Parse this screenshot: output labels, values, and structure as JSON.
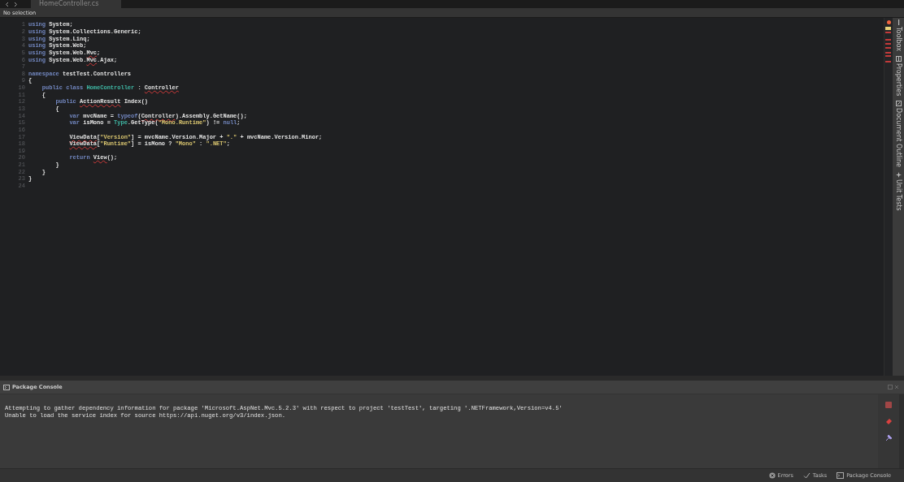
{
  "editor_tab": {
    "title": "HomeController.cs"
  },
  "breadcrumb": "No selection",
  "code_lines": [
    {
      "number": "1",
      "tokens": [
        {
          "text": "using ",
          "kind": "keyword"
        },
        {
          "text": "System;",
          "kind": "text"
        }
      ]
    },
    {
      "number": "2",
      "tokens": [
        {
          "text": "using ",
          "kind": "keyword"
        },
        {
          "text": "System.Collections.Generic;",
          "kind": "text"
        }
      ]
    },
    {
      "number": "3",
      "tokens": [
        {
          "text": "using ",
          "kind": "keyword"
        },
        {
          "text": "System.Linq;",
          "kind": "text"
        }
      ]
    },
    {
      "number": "4",
      "tokens": [
        {
          "text": "using ",
          "kind": "keyword"
        },
        {
          "text": "System.Web;",
          "kind": "text"
        }
      ]
    },
    {
      "number": "5",
      "tokens": [
        {
          "text": "using ",
          "kind": "keyword"
        },
        {
          "text": "System.Web.",
          "kind": "text"
        },
        {
          "text": "Mvc",
          "kind": "error"
        },
        {
          "text": ";",
          "kind": "text"
        }
      ]
    },
    {
      "number": "6",
      "tokens": [
        {
          "text": "using ",
          "kind": "keyword"
        },
        {
          "text": "System.Web.",
          "kind": "text"
        },
        {
          "text": "Mvc",
          "kind": "error"
        },
        {
          "text": ".Ajax;",
          "kind": "text"
        }
      ]
    },
    {
      "number": "7"
    },
    {
      "number": "8",
      "tokens": [
        {
          "text": "namespace ",
          "kind": "keyword"
        },
        {
          "text": "testTest.Controllers",
          "kind": "text"
        }
      ]
    },
    {
      "number": "9",
      "tokens": [
        {
          "text": "{",
          "kind": "text"
        }
      ]
    },
    {
      "number": "10",
      "tokens": [
        {
          "text": "    public class ",
          "kind": "keyword"
        },
        {
          "text": "HomeController",
          "kind": "type"
        },
        {
          "text": " : ",
          "kind": "text"
        },
        {
          "text": "Controller",
          "kind": "error"
        }
      ]
    },
    {
      "number": "11",
      "tokens": [
        {
          "text": "    {",
          "kind": "text"
        }
      ]
    },
    {
      "number": "12",
      "tokens": [
        {
          "text": "        public ",
          "kind": "keyword"
        },
        {
          "text": "ActionResult",
          "kind": "error"
        },
        {
          "text": " Index()",
          "kind": "text"
        }
      ]
    },
    {
      "number": "13",
      "tokens": [
        {
          "text": "        {",
          "kind": "text"
        }
      ]
    },
    {
      "number": "14",
      "tokens": [
        {
          "text": "            var ",
          "kind": "keyword"
        },
        {
          "text": "mvcName = ",
          "kind": "text"
        },
        {
          "text": "typeof",
          "kind": "keyword"
        },
        {
          "text": "(",
          "kind": "text"
        },
        {
          "text": "Controller",
          "kind": "error"
        },
        {
          "text": ").Assembly.GetName();",
          "kind": "text"
        }
      ]
    },
    {
      "number": "15",
      "tokens": [
        {
          "text": "            var ",
          "kind": "keyword"
        },
        {
          "text": "isMono = ",
          "kind": "text"
        },
        {
          "text": "Type",
          "kind": "type"
        },
        {
          "text": ".GetType(",
          "kind": "text"
        },
        {
          "text": "\"Mono.Runtime\"",
          "kind": "string"
        },
        {
          "text": ") != ",
          "kind": "text"
        },
        {
          "text": "null",
          "kind": "keyword"
        },
        {
          "text": ";",
          "kind": "text"
        }
      ]
    },
    {
      "number": "16"
    },
    {
      "number": "17",
      "tokens": [
        {
          "text": "            ViewData",
          "kind": "error"
        },
        {
          "text": "[",
          "kind": "text"
        },
        {
          "text": "\"Version\"",
          "kind": "string"
        },
        {
          "text": "] = mvcName.Version.Major + ",
          "kind": "text"
        },
        {
          "text": "\".\"",
          "kind": "string"
        },
        {
          "text": " + mvcName.Version.Minor;",
          "kind": "text"
        }
      ]
    },
    {
      "number": "18",
      "tokens": [
        {
          "text": "            ViewData",
          "kind": "error"
        },
        {
          "text": "[",
          "kind": "text"
        },
        {
          "text": "\"Runtime\"",
          "kind": "string"
        },
        {
          "text": "] = isMono ? ",
          "kind": "text"
        },
        {
          "text": "\"Mono\"",
          "kind": "string"
        },
        {
          "text": " : ",
          "kind": "text"
        },
        {
          "text": "\".NET\"",
          "kind": "string"
        },
        {
          "text": ";",
          "kind": "text"
        }
      ]
    },
    {
      "number": "19"
    },
    {
      "number": "20",
      "tokens": [
        {
          "text": "            return ",
          "kind": "keyword"
        },
        {
          "text": "View",
          "kind": "error"
        },
        {
          "text": "();",
          "kind": "text"
        }
      ]
    },
    {
      "number": "21",
      "tokens": [
        {
          "text": "        }",
          "kind": "text"
        }
      ]
    },
    {
      "number": "22",
      "tokens": [
        {
          "text": "    }",
          "kind": "text"
        }
      ]
    },
    {
      "number": "23",
      "tokens": [
        {
          "text": "}",
          "kind": "text"
        }
      ]
    },
    {
      "number": "24"
    }
  ],
  "side_pads": [
    {
      "label": "Toolbox"
    },
    {
      "label": "Properties"
    },
    {
      "label": "Document Outline"
    },
    {
      "label": "Unit Tests"
    }
  ],
  "package_console": {
    "title": "Package Console",
    "lines": [
      "Attempting to gather dependency information for package 'Microsoft.AspNet.Mvc.5.2.3' with respect to project 'testTest', targeting '.NETFramework,Version=v4.5'",
      "Unable to load the service index for source https://api.nuget.org/v3/index.json."
    ]
  },
  "status_bar": [
    {
      "label": "Errors"
    },
    {
      "label": "Tasks"
    },
    {
      "label": "Package Console"
    }
  ]
}
